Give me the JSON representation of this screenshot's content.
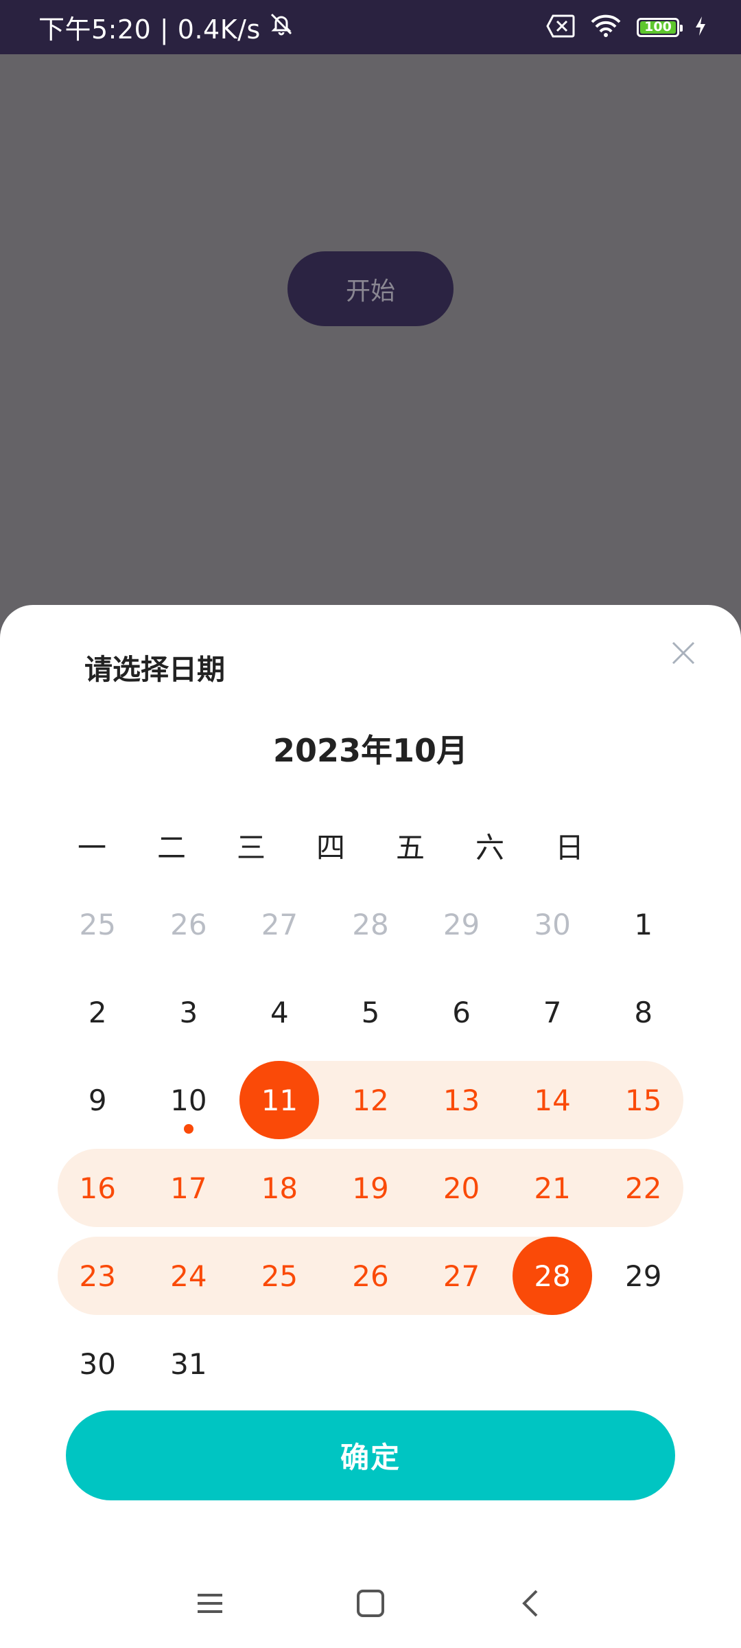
{
  "status_bar": {
    "time_speed": "下午5:20 | 0.4K/s",
    "battery_level": "100",
    "icons": [
      "mute-icon",
      "sim-error-icon",
      "wifi-icon",
      "battery-icon",
      "charging-icon"
    ]
  },
  "start_button": {
    "label": "开始"
  },
  "sheet": {
    "title": "请选择日期",
    "month": "2023年10月",
    "weekdays": [
      "一",
      "二",
      "三",
      "四",
      "五",
      "六",
      "日"
    ],
    "days": [
      [
        "25",
        "26",
        "27",
        "28",
        "29",
        "30",
        "1"
      ],
      [
        "2",
        "3",
        "4",
        "5",
        "6",
        "7",
        "8"
      ],
      [
        "9",
        "10",
        "11",
        "12",
        "13",
        "14",
        "15"
      ],
      [
        "16",
        "17",
        "18",
        "19",
        "20",
        "21",
        "22"
      ],
      [
        "23",
        "24",
        "25",
        "26",
        "27",
        "28",
        "29"
      ],
      [
        "30",
        "31"
      ]
    ],
    "range_start": "11",
    "range_end": "28",
    "today": "10",
    "confirm_label": "确定"
  },
  "colors": {
    "accent": "#fa4a08",
    "range_background": "#fdefe4",
    "confirm": "#00c5c2",
    "status_bar": "#2a2240"
  }
}
